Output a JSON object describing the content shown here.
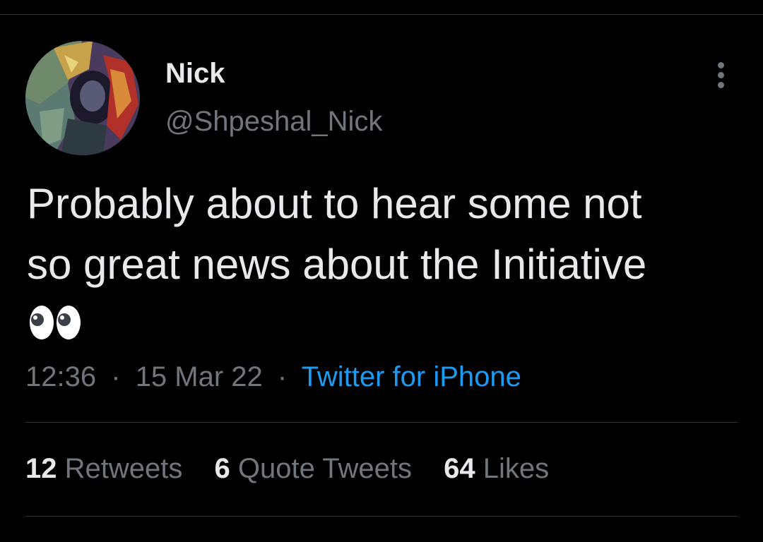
{
  "colors": {
    "background": "#000000",
    "primary_text": "#e7e9ea",
    "secondary_text": "#71767b",
    "link": "#1d9bf0",
    "divider": "#2f3336"
  },
  "author": {
    "display_name": "Nick",
    "handle": "@Shpeshal_Nick",
    "avatar_icon": "avatar-image"
  },
  "menu": {
    "more_icon": "more-vertical-icon"
  },
  "tweet": {
    "text_lines": [
      "Probably about to hear some not",
      "so great news about the Initiative"
    ],
    "emoji": "👀",
    "emoji_name": "eyes-emoji"
  },
  "meta": {
    "time": "12:36",
    "separator": "·",
    "date": "15 Mar 22",
    "source": "Twitter for iPhone"
  },
  "stats": [
    {
      "count": "12",
      "label": "Retweets"
    },
    {
      "count": "6",
      "label": "Quote Tweets"
    },
    {
      "count": "64",
      "label": "Likes"
    }
  ]
}
